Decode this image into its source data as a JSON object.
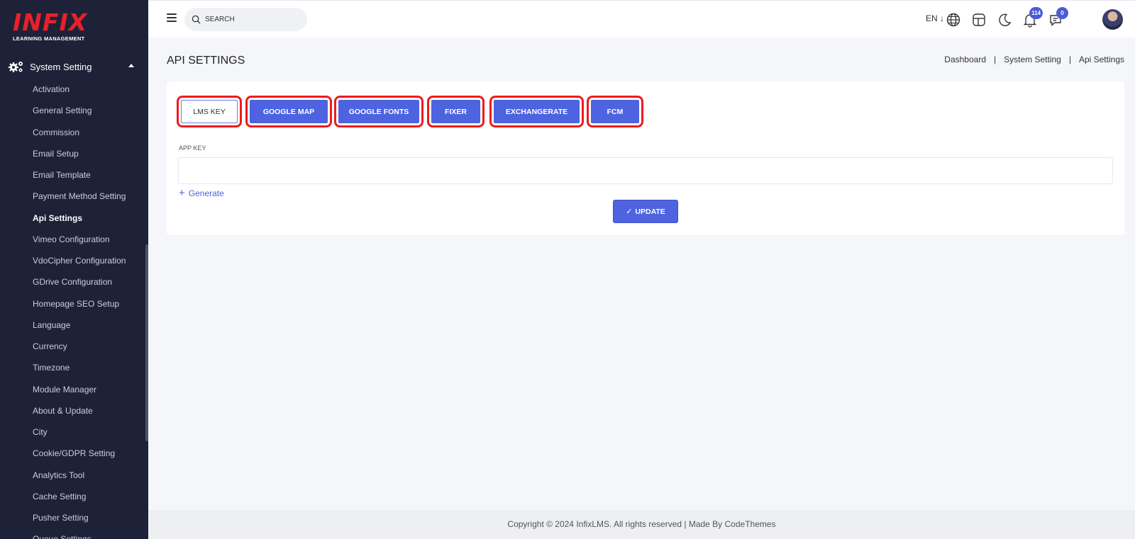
{
  "brand": {
    "logo_text": "INFIX",
    "logo_subtitle": "LEARNING MANAGEMENT"
  },
  "sidebar": {
    "section_title": "System Setting",
    "items": [
      {
        "label": "Activation"
      },
      {
        "label": "General Setting"
      },
      {
        "label": "Commission"
      },
      {
        "label": "Email Setup"
      },
      {
        "label": "Email Template"
      },
      {
        "label": "Payment Method Setting"
      },
      {
        "label": "Api Settings",
        "active": true
      },
      {
        "label": "Vimeo Configuration"
      },
      {
        "label": "VdoCipher Configuration"
      },
      {
        "label": "GDrive Configuration"
      },
      {
        "label": "Homepage SEO Setup"
      },
      {
        "label": "Language"
      },
      {
        "label": "Currency"
      },
      {
        "label": "Timezone"
      },
      {
        "label": "Module Manager"
      },
      {
        "label": "About & Update"
      },
      {
        "label": "City"
      },
      {
        "label": "Cookie/GDPR Setting"
      },
      {
        "label": "Analytics Tool"
      },
      {
        "label": "Cache Setting"
      },
      {
        "label": "Pusher Setting"
      },
      {
        "label": "Queue Settings"
      }
    ]
  },
  "topbar": {
    "search_placeholder": "SEARCH",
    "language": "EN",
    "notifications_count": "114",
    "messages_count": "0",
    "icons": [
      "menu-icon",
      "search-icon",
      "globe-icon",
      "layout-icon",
      "moon-icon",
      "bell-icon",
      "chat-icon",
      "avatar"
    ]
  },
  "header": {
    "title": "API SETTINGS",
    "breadcrumb": [
      "Dashboard",
      "System Setting",
      "Api Settings"
    ]
  },
  "tabs": [
    {
      "label": "LMS KEY",
      "active": true
    },
    {
      "label": "GOOGLE MAP"
    },
    {
      "label": "GOOGLE FONTS"
    },
    {
      "label": "FIXER"
    },
    {
      "label": "EXCHANGERATE"
    },
    {
      "label": "FCM"
    }
  ],
  "form": {
    "field_label": "APP KEY",
    "field_value": "",
    "generate_label": "Generate",
    "update_label": "UPDATE"
  },
  "footer": {
    "text": "Copyright © 2024 InfixLMS. All rights reserved | Made By CodeThemes"
  },
  "colors": {
    "sidebar_bg": "#1e2238",
    "accent": "#4e63e0",
    "highlight_outline": "#ef1b1b",
    "brand_red": "#e8202a"
  }
}
